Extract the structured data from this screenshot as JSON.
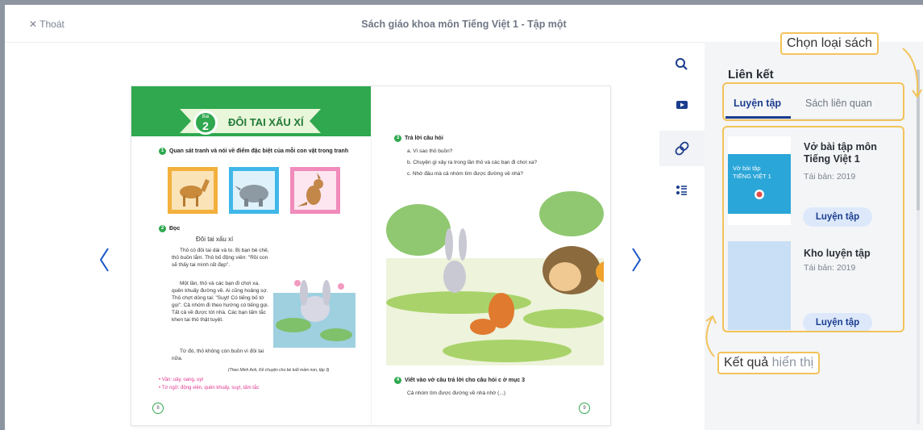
{
  "header": {
    "exit_label": "✕ Thoát",
    "title": "Sách giáo khoa môn Tiếng Việt 1 - Tập một"
  },
  "book": {
    "lesson_small": "Bài",
    "lesson_number": "2",
    "lesson_title": "ĐÔI TAI XẤU XÍ",
    "task1": "Quan sát tranh và nói về điểm đặc biệt của mỗi con vật trong tranh",
    "task2_title": "Đọc",
    "story_title": "Đôi tai xấu xí",
    "story_p1": "Thỏ có đôi tai dài và to. Bị bạn bè chê, thỏ buồn lắm. Thỏ bố động viên: \"Rồi con sẽ thấy tai mình rất đẹp\".",
    "story_p2": "Một lần, thỏ và các bạn đi chơi xa, quên khuấy đường về. Ai cũng hoảng sợ. Thỏ chợt dỏng tai: \"Suỵt! Có tiếng bố tớ gọi\". Cả nhóm đi theo hướng có tiếng gọi. Tất cả về được tới nhà. Các bạn tấm tắc khen tai thỏ thật tuyệt.",
    "story_p3": "Từ đó, thỏ không còn buồn vì đôi tai nữa.",
    "source": "(Theo Minh Anh, Kể chuyện cho bé tuổi mầm non, tập 3)",
    "vocab1": "• Vần: uây, oang, uyt",
    "vocab2": "• Từ ngữ: động viên, quên khuấy, suỵt, tấm tắc",
    "page_left": "8",
    "task3_title": "Trả lời câu hỏi",
    "q_a": "a. Vì sao thỏ buồn?",
    "q_b": "b. Chuyện gì xảy ra trong lần thỏ và các bạn đi chơi xa?",
    "q_c": "c. Nhờ đâu mà cả nhóm tìm được đường về nhà?",
    "task4_title": "Viết vào vở câu trả lời cho câu hỏi c ở mục 3",
    "task4_text": "Cả nhóm tìm được đường về nhà nhờ (...)",
    "page_right": "9",
    "task_numbers": [
      "1",
      "2",
      "3",
      "4"
    ]
  },
  "panel": {
    "heading": "Liên kết",
    "tabs": [
      {
        "label": "Luyện tập",
        "active": true
      },
      {
        "label": "Sách liên quan",
        "active": false
      }
    ],
    "cards": [
      {
        "title": "Vở bài tập môn Tiếng Việt 1",
        "edition": "Tái bản: 2019",
        "button": "Luyện tập",
        "cover_text": "Vở bài tập\nTIẾNG VIỆT 1"
      },
      {
        "title": "Kho luyện tập",
        "edition": "Tái bản: 2019",
        "button": "Luyện tập"
      }
    ]
  },
  "annotations": {
    "choose_type": "Chọn loại sách",
    "result_main": "Kết quả",
    "result_muted": "hiển thị"
  },
  "icons": {
    "prev": "chevron-left-icon",
    "next": "chevron-right-icon",
    "sidebar": [
      "search-icon",
      "video-icon",
      "link-icon",
      "list-icon"
    ]
  },
  "colors": {
    "accent": "#1b3d8e",
    "annotation": "#f2c35a",
    "book_green": "#2fa84f",
    "cover_blue": "#2aa6d8"
  }
}
